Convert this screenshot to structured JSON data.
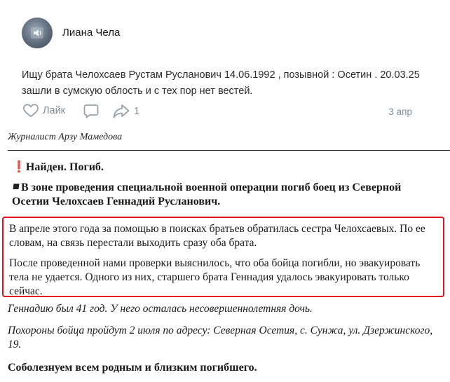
{
  "post": {
    "author": "Лиана Чела",
    "text": "Ищу брата Челохсаев Рустам Русланович 14.06.1992 , позывной : Осетин . 20.03.25 зашли в сумскую облость и с тех пор нет вестей.",
    "like_label": "Лайк",
    "share_count": "1",
    "date": "3 апр",
    "icons": [
      "heart-icon",
      "comment-icon",
      "share-icon",
      "speaker-icon"
    ]
  },
  "article": {
    "journalist": "Журналист Арзу Мамедова",
    "headline1_mark": "❗",
    "headline1": "Найден. Погиб.",
    "headline2": "В зоне проведения специальной военной операции погиб боец из Северной Осетии Челохсаев Геннадий Русланович.",
    "highlight_p1": "В апреле этого года за помощью в поисках братьев обратилась сестра Челохсаевых. По ее словам, на связь перестали выходить сразу оба брата.",
    "highlight_p2": "После проведенной нами проверки выяснилось, что оба бойца погибли, но эвакуировать тела не удается. Одного из них, старшего брата Геннадия удалось эвакуировать только сейчас.",
    "p_age": "Геннадию был 41 год. У него осталась несовершеннолетняя дочь.",
    "p_funeral": "Похороны бойца пройдут 2 июля по адресу: Северная Осетия, с. Сунжа, ул. Дзержинского, 19.",
    "condolences": "Соболезнуем всем родным и близким погибшего.",
    "highlight_color": "#e0141f"
  }
}
